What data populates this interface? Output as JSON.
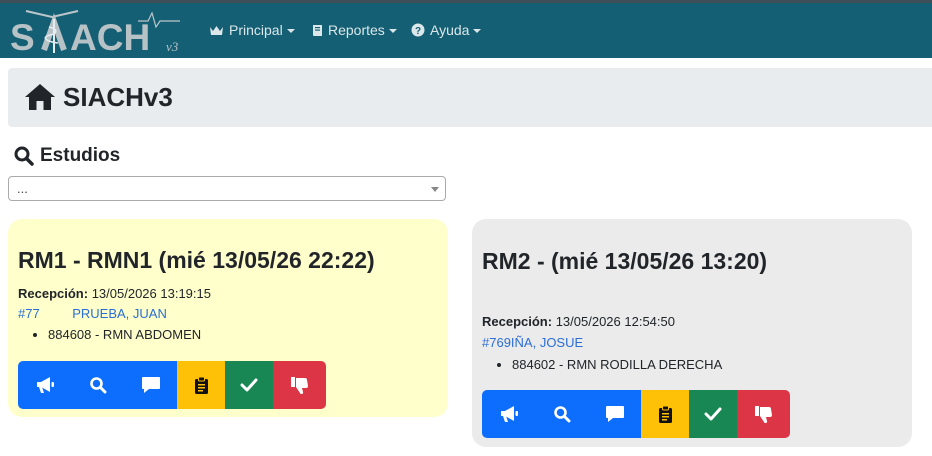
{
  "navbar": {
    "brand": "SIACHv3",
    "menus": [
      {
        "label": "Principal",
        "icon": "crown-icon"
      },
      {
        "label": "Reportes",
        "icon": "book-icon"
      },
      {
        "label": "Ayuda",
        "icon": "question-icon"
      }
    ]
  },
  "header": {
    "title": "SIACHv3",
    "icon": "home-icon"
  },
  "estudios": {
    "label": "Estudios",
    "icon": "search-icon",
    "select_value": "..."
  },
  "cards": [
    {
      "title": "RM1 - RMN1 (mié 13/05/26 22:22)",
      "recepcion_label": "Recepción:",
      "recepcion_value": "13/05/2026 13:19:15",
      "patient": "#77         PRUEBA, JUAN",
      "items": [
        "884608 - RMN ABDOMEN"
      ],
      "background": "#ffffcc"
    },
    {
      "title": "RM2 -  (mié 13/05/26 13:20)",
      "recepcion_label": "Recepción:",
      "recepcion_value": "13/05/2026 12:54:50",
      "patient": "#769IÑA, JOSUE",
      "items": [
        "884602 - RMN RODILLA DERECHA"
      ],
      "background": "#ebebeb"
    }
  ],
  "actions": [
    {
      "icon": "megaphone-icon",
      "color": "#0d6efd"
    },
    {
      "icon": "search-icon",
      "color": "#0d6efd"
    },
    {
      "icon": "comment-icon",
      "color": "#0d6efd"
    },
    {
      "icon": "clipboard-icon",
      "color": "#ffc107"
    },
    {
      "icon": "check-icon",
      "color": "#198754"
    },
    {
      "icon": "thumbs-down-icon",
      "color": "#dc3545"
    }
  ],
  "colors": {
    "navbar": "#145f73",
    "header_bg": "#e9ecef",
    "link": "#2a6ed8"
  }
}
